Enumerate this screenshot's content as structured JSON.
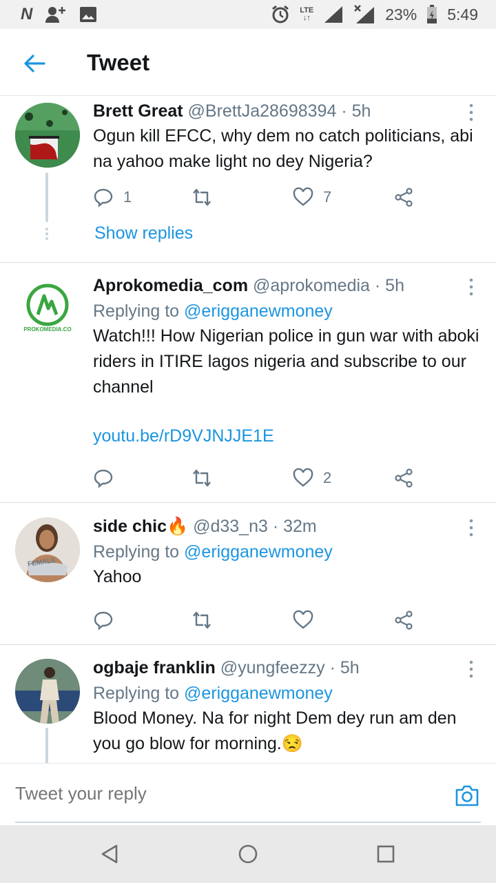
{
  "status_bar": {
    "carrier_icon": "N",
    "lte_top": "LTE",
    "lte_arrows": "↓↑",
    "battery": "23%",
    "time": "5:49",
    "icons": [
      "n-icon",
      "add-user-icon",
      "image-icon",
      "alarm-icon",
      "signal-icon",
      "battery-icon"
    ]
  },
  "header": {
    "title": "Tweet"
  },
  "tweets": [
    {
      "name": "Brett Great",
      "handle": "@BrettJa28698394",
      "sep": "·",
      "time": "5h",
      "text": "Ogun kill EFCC, why dem no catch politicians, abi na yahoo make light no dey Nigeria?",
      "replies": "1",
      "retweets": "",
      "likes": "7",
      "show_replies": "Show replies"
    },
    {
      "name": "Aprokomedia_com",
      "handle": "@aprokomedia",
      "sep": "·",
      "time": "5h",
      "replying_prefix": "Replying to ",
      "replying_to": "@erigganewmoney",
      "text": "Watch!!! How Nigerian police in gun war with aboki riders in ITIRE lagos nigeria and subscribe to our channel",
      "link": "youtu.be/rD9VJNJJE1E",
      "avatar_caption": "PROKOMEDIA.CO",
      "replies": "",
      "retweets": "",
      "likes": "2"
    },
    {
      "name": "side chic🔥",
      "handle": "@d33_n3",
      "sep": "·",
      "time": "32m",
      "replying_prefix": "Replying to ",
      "replying_to": "@erigganewmoney",
      "text": "Yahoo",
      "avatar_caption": "FEMALE",
      "replies": "",
      "retweets": "",
      "likes": ""
    },
    {
      "name": "ogbaje franklin",
      "handle": "@yungfeezzy",
      "sep": "·",
      "time": "5h",
      "replying_prefix": "Replying to ",
      "replying_to": "@erigganewmoney",
      "text": "Blood Money. Na for night Dem dey run am den you go blow for morning.😒"
    }
  ],
  "composer": {
    "placeholder": "Tweet your reply"
  },
  "colors": {
    "accent": "#1b95e0",
    "muted": "#657786",
    "text": "#14171a"
  }
}
